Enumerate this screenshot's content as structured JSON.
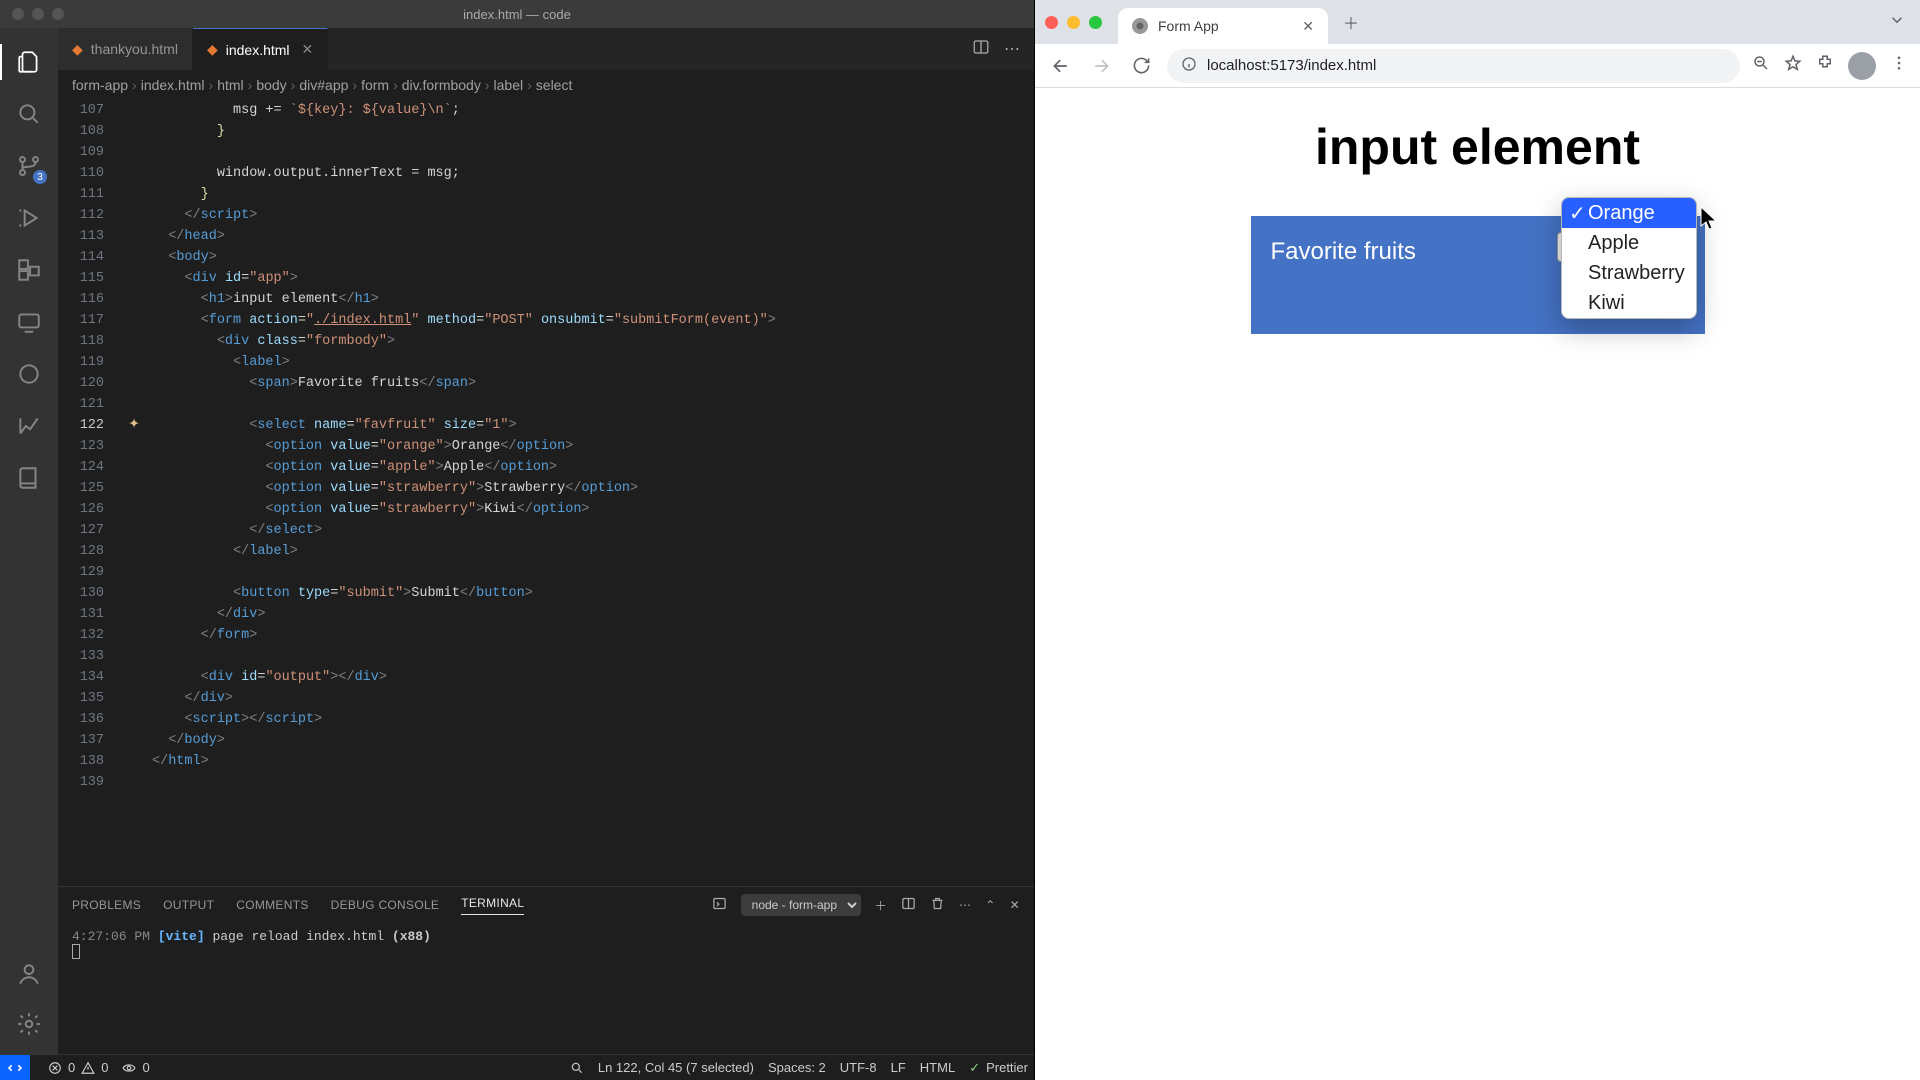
{
  "vscode": {
    "window_title": "index.html — code",
    "tabs": [
      {
        "name": "thankyou.html"
      },
      {
        "name": "index.html"
      }
    ],
    "breadcrumbs": [
      "form-app",
      "index.html",
      "html",
      "body",
      "div#app",
      "form",
      "div.formbody",
      "label",
      "select"
    ],
    "active_line": 122,
    "scm_badge": "3",
    "terminal_select": "node - form-app",
    "panel_tabs": [
      "PROBLEMS",
      "OUTPUT",
      "COMMENTS",
      "DEBUG CONSOLE",
      "TERMINAL"
    ],
    "terminal": {
      "time": "4:27:06 PM",
      "tag": "[vite]",
      "msg": "page reload index.html",
      "count": "(x88)"
    },
    "status": {
      "err": "0",
      "warn": "0",
      "port": "0",
      "cursor": "Ln 122, Col 45 (7 selected)",
      "spaces": "Spaces: 2",
      "enc": "UTF-8",
      "eol": "LF",
      "lang": "HTML",
      "prettier": "Prettier"
    },
    "code": {
      "line_start": 107,
      "lines": [
        {
          "indent": 10,
          "html": "<span class='tx'>msg += </span><span class='s'>`${key}: ${value}\\n`</span><span class='tx'>;</span>"
        },
        {
          "indent": 8,
          "html": "<span class='y'>}</span>"
        },
        {
          "indent": 0,
          "html": ""
        },
        {
          "indent": 8,
          "html": "<span class='tx'>window.output.innerText = msg;</span>"
        },
        {
          "indent": 6,
          "html": "<span class='y'>}</span>"
        },
        {
          "indent": 4,
          "html": "<span class='b'>&lt;/</span><span class='t'>script</span><span class='b'>&gt;</span>"
        },
        {
          "indent": 2,
          "html": "<span class='b'>&lt;/</span><span class='t'>head</span><span class='b'>&gt;</span>"
        },
        {
          "indent": 2,
          "html": "<span class='b'>&lt;</span><span class='t'>body</span><span class='b'>&gt;</span>"
        },
        {
          "indent": 4,
          "html": "<span class='b'>&lt;</span><span class='t'>div</span> <span class='a'>id</span><span class='eq'>=</span><span class='s'>\"app\"</span><span class='b'>&gt;</span>"
        },
        {
          "indent": 6,
          "html": "<span class='b'>&lt;</span><span class='t'>h1</span><span class='b'>&gt;</span><span class='tx'>input element</span><span class='b'>&lt;/</span><span class='t'>h1</span><span class='b'>&gt;</span>"
        },
        {
          "indent": 6,
          "html": "<span class='b'>&lt;</span><span class='t'>form</span> <span class='a'>action</span><span class='eq'>=</span><span class='s'>\"<u>./index.html</u>\"</span> <span class='a'>method</span><span class='eq'>=</span><span class='s'>\"POST\"</span> <span class='a'>onsubmit</span><span class='eq'>=</span><span class='s'>\"submitForm(event)\"</span><span class='b'>&gt;</span>"
        },
        {
          "indent": 8,
          "html": "<span class='b'>&lt;</span><span class='t'>div</span> <span class='a'>class</span><span class='eq'>=</span><span class='s'>\"formbody\"</span><span class='b'>&gt;</span>"
        },
        {
          "indent": 10,
          "html": "<span class='b'>&lt;</span><span class='t'>label</span><span class='b'>&gt;</span>"
        },
        {
          "indent": 12,
          "html": "<span class='b'>&lt;</span><span class='t'>span</span><span class='b'>&gt;</span><span class='tx'>Favorite fruits</span><span class='b'>&lt;/</span><span class='t'>span</span><span class='b'>&gt;</span>"
        },
        {
          "indent": 0,
          "html": ""
        },
        {
          "indent": 12,
          "html": "<span class='b'>&lt;</span><span class='t'>select</span> <span class='a'>name</span><span class='eq'>=</span><span class='s'>\"favfruit\"</span> <span class='a'>size</span><span class='eq'>=</span><span class='s'>\"1\"</span><span class='b'>&gt;</span>"
        },
        {
          "indent": 14,
          "html": "<span class='b'>&lt;</span><span class='t'>option</span> <span class='a'>value</span><span class='eq'>=</span><span class='s'>\"orange\"</span><span class='b'>&gt;</span><span class='tx'>Orange</span><span class='b'>&lt;/</span><span class='t'>option</span><span class='b'>&gt;</span>"
        },
        {
          "indent": 14,
          "html": "<span class='b'>&lt;</span><span class='t'>option</span> <span class='a'>value</span><span class='eq'>=</span><span class='s'>\"apple\"</span><span class='b'>&gt;</span><span class='tx'>Apple</span><span class='b'>&lt;/</span><span class='t'>option</span><span class='b'>&gt;</span>"
        },
        {
          "indent": 14,
          "html": "<span class='b'>&lt;</span><span class='t'>option</span> <span class='a'>value</span><span class='eq'>=</span><span class='s'>\"strawberry\"</span><span class='b'>&gt;</span><span class='tx'>Strawberry</span><span class='b'>&lt;/</span><span class='t'>option</span><span class='b'>&gt;</span>"
        },
        {
          "indent": 14,
          "html": "<span class='b'>&lt;</span><span class='t'>option</span> <span class='a'>value</span><span class='eq'>=</span><span class='s'>\"strawberry\"</span><span class='b'>&gt;</span><span class='tx'>Kiwi</span><span class='b'>&lt;/</span><span class='t'>option</span><span class='b'>&gt;</span>"
        },
        {
          "indent": 12,
          "html": "<span class='b'>&lt;/</span><span class='t'>select</span><span class='b'>&gt;</span>"
        },
        {
          "indent": 10,
          "html": "<span class='b'>&lt;/</span><span class='t'>label</span><span class='b'>&gt;</span>"
        },
        {
          "indent": 0,
          "html": ""
        },
        {
          "indent": 10,
          "html": "<span class='b'>&lt;</span><span class='t'>button</span> <span class='a'>type</span><span class='eq'>=</span><span class='s'>\"submit\"</span><span class='b'>&gt;</span><span class='tx'>Submit</span><span class='b'>&lt;/</span><span class='t'>button</span><span class='b'>&gt;</span>"
        },
        {
          "indent": 8,
          "html": "<span class='b'>&lt;/</span><span class='t'>div</span><span class='b'>&gt;</span>"
        },
        {
          "indent": 6,
          "html": "<span class='b'>&lt;/</span><span class='t'>form</span><span class='b'>&gt;</span>"
        },
        {
          "indent": 0,
          "html": ""
        },
        {
          "indent": 6,
          "html": "<span class='b'>&lt;</span><span class='t'>div</span> <span class='a'>id</span><span class='eq'>=</span><span class='s'>\"output\"</span><span class='b'>&gt;&lt;/</span><span class='t'>div</span><span class='b'>&gt;</span>"
        },
        {
          "indent": 4,
          "html": "<span class='b'>&lt;/</span><span class='t'>div</span><span class='b'>&gt;</span>"
        },
        {
          "indent": 4,
          "html": "<span class='b'>&lt;</span><span class='t'>script</span><span class='b'>&gt;&lt;/</span><span class='t'>script</span><span class='b'>&gt;</span>"
        },
        {
          "indent": 2,
          "html": "<span class='b'>&lt;/</span><span class='t'>body</span><span class='b'>&gt;</span>"
        },
        {
          "indent": 0,
          "html": "<span class='b'>&lt;/</span><span class='t'>html</span><span class='b'>&gt;</span>"
        },
        {
          "indent": 0,
          "html": ""
        }
      ]
    }
  },
  "browser": {
    "tab_title": "Form App",
    "url": "localhost:5173/index.html",
    "page_title": "input element",
    "form_label": "Favorite fruits",
    "options": [
      "Orange",
      "Apple",
      "Strawberry",
      "Kiwi"
    ],
    "selected": "Orange"
  }
}
